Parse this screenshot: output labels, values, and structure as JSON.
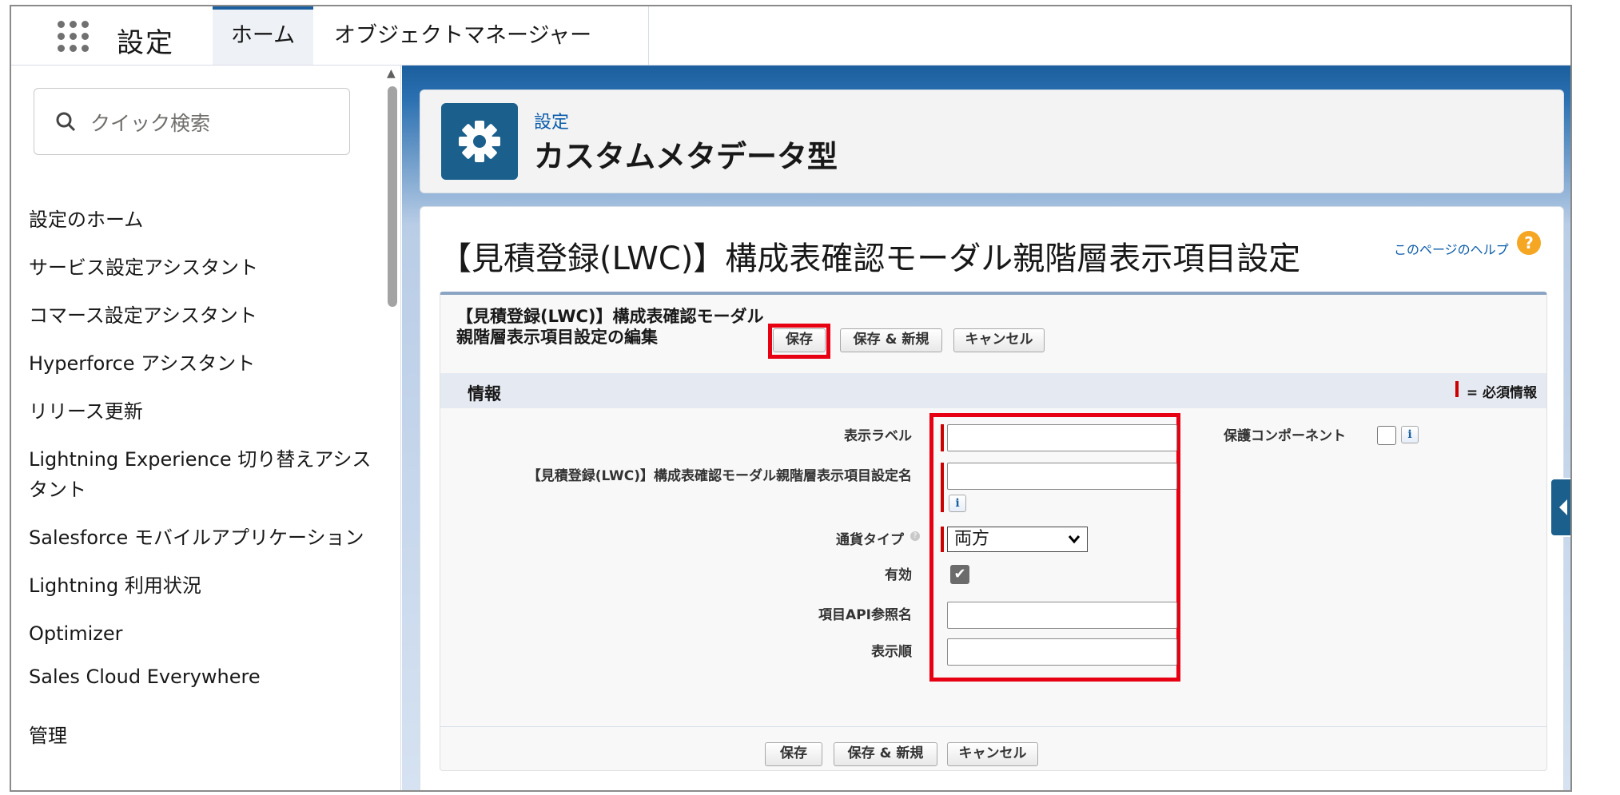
{
  "header": {
    "app_name": "設定",
    "tabs": [
      {
        "label": "ホーム"
      },
      {
        "label": "オブジェクトマネージャー"
      }
    ]
  },
  "sidebar": {
    "search_placeholder": "クイック検索",
    "items": [
      {
        "label": "設定のホーム"
      },
      {
        "label": "サービス設定アシスタント"
      },
      {
        "label": "コマース設定アシスタント"
      },
      {
        "label": "Hyperforce アシスタント"
      },
      {
        "label": "リリース更新"
      },
      {
        "label": "Lightning Experience 切り替えアシスタント"
      },
      {
        "label": "Salesforce モバイルアプリケーション"
      },
      {
        "label": "Lightning 利用状況"
      },
      {
        "label": "Optimizer"
      },
      {
        "label": "Sales Cloud Everywhere"
      }
    ],
    "section_label": "管理"
  },
  "page_header": {
    "breadcrumb": "設定",
    "title": "カスタムメタデータ型"
  },
  "content": {
    "page_title": "【見積登録(LWC)】構成表確認モーダル親階層表示項目設定",
    "help_link": "このページのヘルプ",
    "edit_title": "【見積登録(LWC)】構成表確認モーダル親階層表示項目設定の編集",
    "buttons": {
      "save": "保存",
      "save_new": "保存 & 新規",
      "cancel": "キャンセル"
    },
    "section_title": "情報",
    "required_note": "= 必須情報",
    "fields": {
      "label": {
        "label": "表示ラベル",
        "value": ""
      },
      "name": {
        "label": "【見積登録(LWC)】構成表確認モーダル親階層表示項目設定名",
        "value": ""
      },
      "currency_type": {
        "label": "通貨タイプ",
        "value": "両方"
      },
      "active": {
        "label": "有効",
        "checked": true
      },
      "api_name": {
        "label": "項目API参照名",
        "value": ""
      },
      "display_order": {
        "label": "表示順",
        "value": ""
      },
      "protected": {
        "label": "保護コンポーネント",
        "checked": false
      }
    }
  },
  "colors": {
    "brand": "#1b5f9e",
    "highlight": "#e60012",
    "required": "#cc0000"
  }
}
